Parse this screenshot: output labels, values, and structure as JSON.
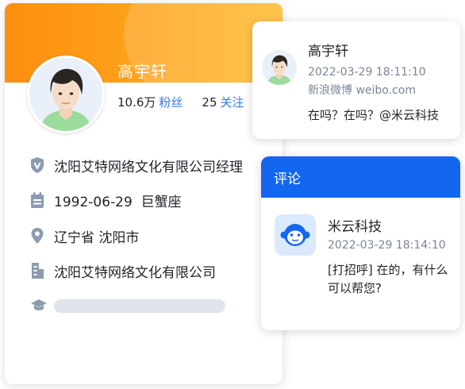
{
  "profile": {
    "name": "高宇轩",
    "followers_count": "10.6万",
    "followers_label": "粉丝",
    "following_count": "25",
    "following_label": "关注",
    "details": [
      {
        "icon": "verified-shield-icon",
        "text": "沈阳艾特网络文化有限公司经理"
      },
      {
        "icon": "calendar-icon",
        "text": "1992-06-29  巨蟹座"
      },
      {
        "icon": "location-pin-icon",
        "text": "辽宁省 沈阳市"
      },
      {
        "icon": "company-building-icon",
        "text": "沈阳艾特网络文化有限公司"
      }
    ],
    "education_icon": "graduation-cap-icon"
  },
  "message": {
    "name": "高宇轩",
    "time": "2022-03-29 18:11:10",
    "source": "新浪微博 weibo.com",
    "text": "在吗？在吗？@米云科技"
  },
  "comment": {
    "header": "评论",
    "name": "米云科技",
    "time": "2022-03-29 18:14:10",
    "text": "[打招呼] 在的，有什么可以帮您?"
  },
  "colors": {
    "header_orange": "#fd8e0f",
    "link_blue": "#2f7cf6",
    "comment_header_blue": "#1366ee",
    "icon_gray": "#8c9bb0"
  }
}
